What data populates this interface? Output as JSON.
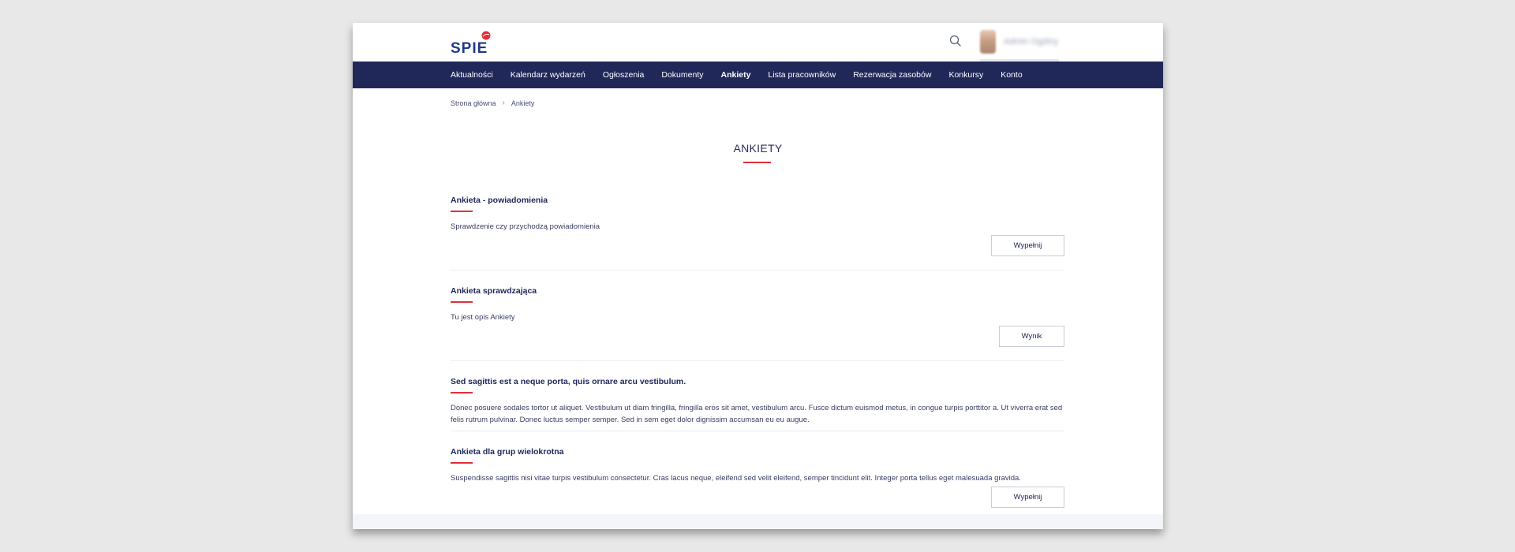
{
  "header": {
    "logo_text": "SPIE",
    "user_name": "Admin Ogólny"
  },
  "nav": {
    "items": [
      {
        "label": "Aktualności"
      },
      {
        "label": "Kalendarz wydarzeń"
      },
      {
        "label": "Ogłoszenia"
      },
      {
        "label": "Dokumenty"
      },
      {
        "label": "Ankiety",
        "active": true
      },
      {
        "label": "Lista pracowników"
      },
      {
        "label": "Rezerwacja zasobów"
      },
      {
        "label": "Konkursy"
      },
      {
        "label": "Konto"
      }
    ]
  },
  "breadcrumb": {
    "home": "Strona główna",
    "current": "Ankiety"
  },
  "page": {
    "title": "ANKIETY"
  },
  "surveys": [
    {
      "title": "Ankieta - powiadomienia",
      "description": "Sprawdzenie czy przychodzą powiadomienia",
      "button": "Wypełnij"
    },
    {
      "title": "Ankieta sprawdzająca",
      "description": "Tu jest opis Ankiety",
      "button": "Wynik"
    },
    {
      "title": "Sed sagittis est a neque porta, quis ornare arcu vestibulum.",
      "description": "Donec posuere sodales tortor ut aliquet. Vestibulum ut diam fringilla, fringilla eros sit amet, vestibulum arcu. Fusce dictum euismod metus, in congue turpis porttitor a. Ut viverra erat sed felis rutrum pulvinar. Donec luctus semper semper. Sed in sem eget dolor dignissim accumsan eu eu augue.",
      "button": ""
    },
    {
      "title": "Ankieta dla grup wielokrotna",
      "description": "Suspendisse sagittis nisi vitae turpis vestibulum consectetur. Cras lacus neque, eleifend sed velit eleifend, semper tincidunt elit. Integer porta tellus eget malesuada gravida.",
      "button": "Wypełnij"
    }
  ],
  "colors": {
    "navy": "#20285a",
    "accent_red": "#e0303a"
  }
}
